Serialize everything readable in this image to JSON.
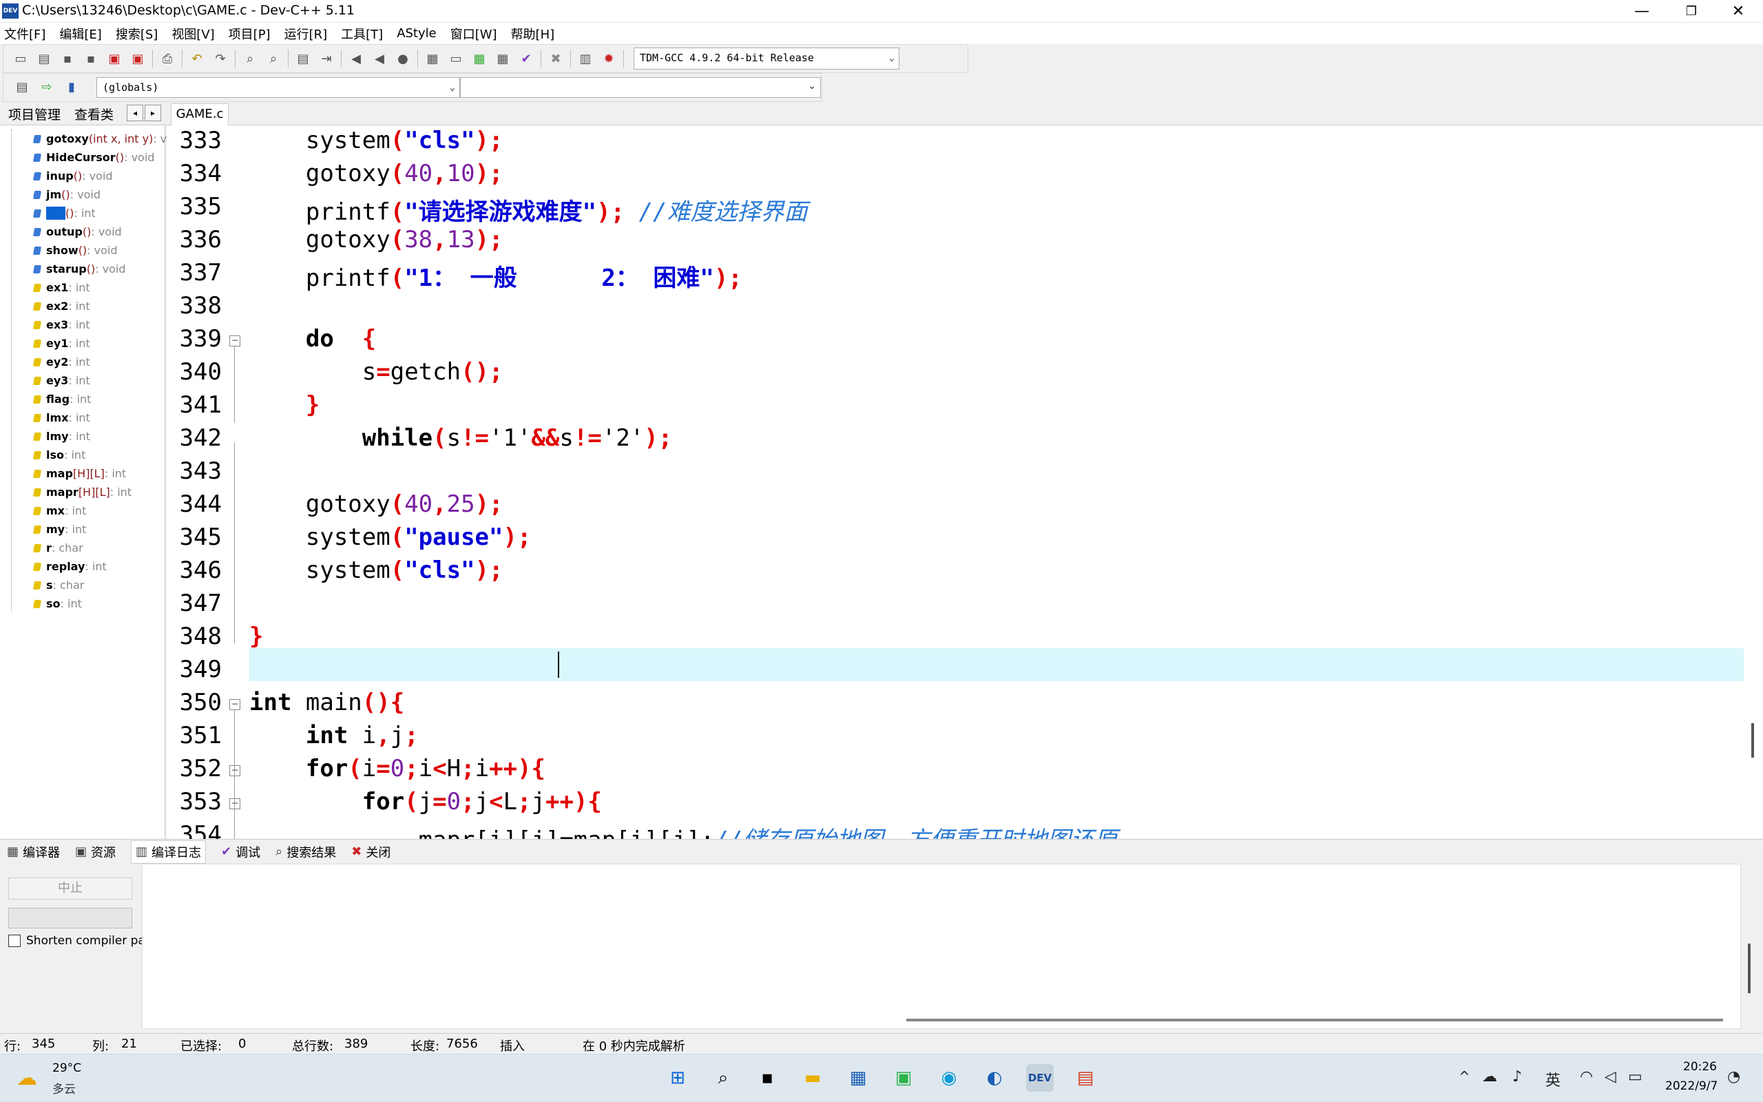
{
  "window": {
    "title": "C:\\Users\\13246\\Desktop\\c\\GAME.c - Dev-C++ 5.11",
    "icon_label": "DEV",
    "controls": [
      "—",
      "❐",
      "✕"
    ]
  },
  "menu": [
    "文件[F]",
    "编辑[E]",
    "搜索[S]",
    "视图[V]",
    "项目[P]",
    "运行[R]",
    "工具[T]",
    "AStyle",
    "窗口[W]",
    "帮助[H]"
  ],
  "toolbar": {
    "compiler": "TDM-GCC 4.9.2 64-bit Release",
    "scope": "(globals)"
  },
  "left_panel": {
    "tabs": [
      "项目管理",
      "查看类"
    ],
    "nav": [
      "◂",
      "▸"
    ],
    "items": [
      {
        "kind": "function",
        "name": "gotoxy",
        "args": "(int x, int y)",
        "type": " : v"
      },
      {
        "kind": "function",
        "name": "HideCursor",
        "args": " ()",
        "type": " : void"
      },
      {
        "kind": "function",
        "name": "inup",
        "args": " ()",
        "type": " : void"
      },
      {
        "kind": "function",
        "name": "jm",
        "args": " ()",
        "type": " : void"
      },
      {
        "kind": "function",
        "name": "",
        "args": " ()",
        "type": " : int"
      },
      {
        "kind": "function",
        "name": "outup",
        "args": " ()",
        "type": " : void"
      },
      {
        "kind": "function",
        "name": "show",
        "args": " ()",
        "type": " : void"
      },
      {
        "kind": "function",
        "name": "starup",
        "args": " ()",
        "type": " : void"
      },
      {
        "kind": "variable",
        "name": "ex1",
        "args": "",
        "type": " : int"
      },
      {
        "kind": "variable",
        "name": "ex2",
        "args": "",
        "type": " : int"
      },
      {
        "kind": "variable",
        "name": "ex3",
        "args": "",
        "type": " : int"
      },
      {
        "kind": "variable",
        "name": "ey1",
        "args": "",
        "type": " : int"
      },
      {
        "kind": "variable",
        "name": "ey2",
        "args": "",
        "type": " : int"
      },
      {
        "kind": "variable",
        "name": "ey3",
        "args": "",
        "type": " : int"
      },
      {
        "kind": "variable",
        "name": "flag",
        "args": "",
        "type": " : int"
      },
      {
        "kind": "variable",
        "name": "lmx",
        "args": "",
        "type": " : int"
      },
      {
        "kind": "variable",
        "name": "lmy",
        "args": "",
        "type": " : int"
      },
      {
        "kind": "variable",
        "name": "lso",
        "args": "",
        "type": " : int"
      },
      {
        "kind": "variable",
        "name": "map",
        "args": " [H][L]",
        "type": " : int"
      },
      {
        "kind": "variable",
        "name": "mapr",
        "args": " [H][L]",
        "type": " : int"
      },
      {
        "kind": "variable",
        "name": "mx",
        "args": "",
        "type": " : int"
      },
      {
        "kind": "variable",
        "name": "my",
        "args": "",
        "type": " : int"
      },
      {
        "kind": "variable",
        "name": "r",
        "args": "",
        "type": " : char"
      },
      {
        "kind": "variable",
        "name": "replay",
        "args": "",
        "type": " : int"
      },
      {
        "kind": "variable",
        "name": "s",
        "args": "",
        "type": " : char"
      },
      {
        "kind": "variable",
        "name": "so",
        "args": "",
        "type": " : int"
      }
    ]
  },
  "editor": {
    "file_tab": "GAME.c",
    "lines": [
      {
        "n": "333",
        "tokens": [
          [
            "",
            "    system"
          ],
          [
            "punc",
            "("
          ],
          [
            "str",
            "\"cls\""
          ],
          [
            "punc",
            ");"
          ]
        ]
      },
      {
        "n": "334",
        "tokens": [
          [
            "",
            "    gotoxy"
          ],
          [
            "punc",
            "("
          ],
          [
            "num",
            "40"
          ],
          [
            "punc",
            ","
          ],
          [
            "num",
            "10"
          ],
          [
            "punc",
            ");"
          ]
        ]
      },
      {
        "n": "335",
        "tokens": [
          [
            "",
            "    printf"
          ],
          [
            "punc",
            "("
          ],
          [
            "str",
            "\"请选择游戏难度\""
          ],
          [
            "punc",
            ");"
          ],
          [
            "",
            " "
          ],
          [
            "cmt",
            "//难度选择界面"
          ]
        ]
      },
      {
        "n": "336",
        "tokens": [
          [
            "",
            "    gotoxy"
          ],
          [
            "punc",
            "("
          ],
          [
            "num",
            "38"
          ],
          [
            "punc",
            ","
          ],
          [
            "num",
            "13"
          ],
          [
            "punc",
            ");"
          ]
        ]
      },
      {
        "n": "337",
        "tokens": [
          [
            "",
            "    printf"
          ],
          [
            "punc",
            "("
          ],
          [
            "str",
            "\"1： 一般      2： 困难\""
          ],
          [
            "punc",
            ");"
          ]
        ]
      },
      {
        "n": "338",
        "tokens": []
      },
      {
        "n": "339",
        "tokens": [
          [
            "kw",
            "    do"
          ],
          [
            "",
            "  "
          ],
          [
            "punc",
            "{"
          ]
        ]
      },
      {
        "n": "340",
        "tokens": [
          [
            "",
            "        s"
          ],
          [
            "punc",
            "="
          ],
          [
            "",
            "getch"
          ],
          [
            "punc",
            "();"
          ]
        ]
      },
      {
        "n": "341",
        "tokens": [
          [
            "punc",
            "    }"
          ]
        ]
      },
      {
        "n": "342",
        "tokens": [
          [
            "kw",
            "        while"
          ],
          [
            "punc",
            "("
          ],
          [
            "",
            "s"
          ],
          [
            "punc",
            "!="
          ],
          [
            "",
            "'1'"
          ],
          [
            "punc",
            "&&"
          ],
          [
            "",
            "s"
          ],
          [
            "punc",
            "!="
          ],
          [
            "",
            "'2'"
          ],
          [
            "punc",
            ");"
          ]
        ]
      },
      {
        "n": "343",
        "tokens": []
      },
      {
        "n": "344",
        "tokens": [
          [
            "",
            "    gotoxy"
          ],
          [
            "punc",
            "("
          ],
          [
            "num",
            "40"
          ],
          [
            "punc",
            ","
          ],
          [
            "num",
            "25"
          ],
          [
            "punc",
            ");"
          ]
        ]
      },
      {
        "n": "345",
        "tokens": [
          [
            "",
            "    system"
          ],
          [
            "punc",
            "("
          ],
          [
            "str",
            "\"pause\""
          ],
          [
            "punc",
            ");"
          ]
        ]
      },
      {
        "n": "346",
        "tokens": [
          [
            "",
            "    system"
          ],
          [
            "punc",
            "("
          ],
          [
            "str",
            "\"cls\""
          ],
          [
            "punc",
            ");"
          ]
        ]
      },
      {
        "n": "347",
        "tokens": []
      },
      {
        "n": "348",
        "tokens": [
          [
            "punc",
            "}"
          ]
        ]
      },
      {
        "n": "349",
        "tokens": []
      },
      {
        "n": "350",
        "tokens": [
          [
            "kw",
            "int"
          ],
          [
            "",
            " main"
          ],
          [
            "punc",
            "(){"
          ]
        ]
      },
      {
        "n": "351",
        "tokens": [
          [
            "kw",
            "    int"
          ],
          [
            "",
            " i"
          ],
          [
            "punc",
            ","
          ],
          [
            "",
            "j"
          ],
          [
            "punc",
            ";"
          ]
        ]
      },
      {
        "n": "352",
        "tokens": [
          [
            "kw",
            "    for"
          ],
          [
            "punc",
            "("
          ],
          [
            "",
            "i"
          ],
          [
            "punc",
            "="
          ],
          [
            "num",
            "0"
          ],
          [
            "punc",
            ";"
          ],
          [
            "",
            "i"
          ],
          [
            "punc",
            "<"
          ],
          [
            "",
            "H"
          ],
          [
            "punc",
            ";"
          ],
          [
            "",
            "i"
          ],
          [
            "punc",
            "++){"
          ]
        ]
      },
      {
        "n": "353",
        "tokens": [
          [
            "kw",
            "        for"
          ],
          [
            "punc",
            "("
          ],
          [
            "",
            "j"
          ],
          [
            "punc",
            "="
          ],
          [
            "num",
            "0"
          ],
          [
            "punc",
            ";"
          ],
          [
            "",
            "j"
          ],
          [
            "punc",
            "<"
          ],
          [
            "",
            "L"
          ],
          [
            "punc",
            ";"
          ],
          [
            "",
            "j"
          ],
          [
            "punc",
            "++){"
          ]
        ]
      },
      {
        "n": "354",
        "tokens": [
          [
            "",
            "            mapr[i][j]=map[i][j];"
          ],
          [
            "cmt",
            "//储存原始地图，方便重开时地图还原"
          ]
        ]
      }
    ],
    "current_line": "345"
  },
  "bottom_panel": {
    "tabs": [
      {
        "icon": "▦",
        "label": "编译器"
      },
      {
        "icon": "▣",
        "label": "资源"
      },
      {
        "icon": "▥",
        "label": "编译日志"
      },
      {
        "icon": "✔",
        "label": "调试"
      },
      {
        "icon": "⌕",
        "label": "搜索结果"
      },
      {
        "icon": "✖",
        "label": "关闭"
      }
    ],
    "stop_label": "中止",
    "shorten_label": "Shorten compiler pa"
  },
  "status": {
    "row_label": "行:",
    "row": "345",
    "col_label": "列:",
    "col": "21",
    "sel_label": "已选择:",
    "sel": "0",
    "total_label": "总行数:",
    "total": "389",
    "len_label": "长度:",
    "len": "7656",
    "mode": "插入",
    "parse": "在 0 秒内完成解析"
  },
  "taskbar": {
    "weather_temp": "29°C",
    "weather_desc": "多云",
    "ime": "英",
    "time": "20:26",
    "date": "2022/9/7",
    "caret_up": "^"
  }
}
